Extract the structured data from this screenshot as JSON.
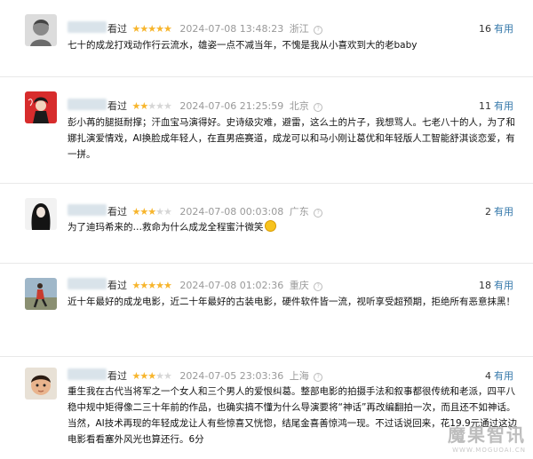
{
  "reviews": [
    {
      "seen": "看过",
      "rating": 5,
      "date": "2024-07-08 13:48:23",
      "location": "浙江",
      "useful_count": "16",
      "useful_label": "有用",
      "content": "七十的成龙打戏动作行云流水，雄姿一点不减当年，不愧是我从小喜欢到大的老baby",
      "avatar": "avatar-gray-portrait"
    },
    {
      "seen": "看过",
      "rating": 2,
      "date": "2024-07-06 21:25:59",
      "location": "北京",
      "useful_count": "11",
      "useful_label": "有用",
      "content": "彭小苒的腿挺耐撑；汗血宝马演得好。史诗级灾难，避雷，这么土的片子，我想骂人。七老八十的人，为了和娜扎演爱情戏，AI换脸成年轻人，在直男癌赛道，成龙可以和马小刚让葛优和年轻版人工智能舒淇谈恋爱，有一拼。",
      "avatar": "avatar-red-figure"
    },
    {
      "seen": "看过",
      "rating": 3,
      "date": "2024-07-08 00:03:08",
      "location": "广东",
      "useful_count": "2",
      "useful_label": "有用",
      "content": "为了迪玛希来的…救命为什么成龙全程蜜汁微笑",
      "avatar": "avatar-long-hair-woman"
    },
    {
      "seen": "看过",
      "rating": 5,
      "date": "2024-07-08 01:02:36",
      "location": "重庆",
      "useful_count": "18",
      "useful_label": "有用",
      "content": "近十年最好的成龙电影，近二十年最好的古装电影，硬件软件皆一流，视听享受超预期，拒绝所有恶意抹黑！",
      "avatar": "avatar-running-person"
    },
    {
      "seen": "看过",
      "rating": 3,
      "date": "2024-07-05 23:03:36",
      "location": "上海",
      "useful_count": "4",
      "useful_label": "有用",
      "content": "重生我在古代当将军之一个女人和三个男人的爱恨纠葛。整部电影的拍摄手法和叙事都很传统和老派，四平八稳中规中矩得像二三十年前的作品，也确实搞不懂为什么导演要将“神话”再改编翻拍一次，而且还不如神话。当然，AI技术再现的年轻成龙让人有些惊喜又恍惚，结尾金喜善惊鸿一现。不过话说回来，花19.9元通过这边电影看看塞外风光也算还行。6分",
      "avatar": "avatar-child"
    }
  ],
  "watermark": {
    "text": "魔果智讯",
    "url": "WWW.MOGUOAI.CN"
  },
  "colors": {
    "star": "#f7b52c",
    "link": "#3377aa",
    "meta": "#999999"
  }
}
